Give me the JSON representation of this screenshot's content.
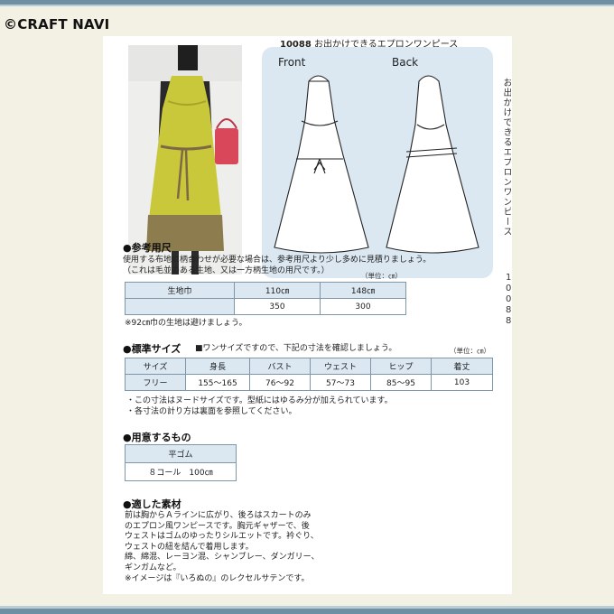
{
  "brand": "©CRAFT NAVI",
  "header": {
    "code": "10088",
    "name": "お出かけできるエプロンワンピース"
  },
  "diagram": {
    "front_label": "Front",
    "back_label": "Back"
  },
  "side": {
    "vertical_text": "お出かけできるエプロンワンピース",
    "digits": [
      "1",
      "0",
      "0",
      "8",
      "8"
    ]
  },
  "section_fabric": {
    "heading": "●参考用尺",
    "lines": [
      "使用する布地に柄合わせが必要な場合は、参考用尺より少し多めに見積りましょう。",
      "（これは毛並のある生地、又は一方柄生地の用尺です。）"
    ],
    "unit": "（単位：㎝）",
    "row_header": "生地巾",
    "widths": [
      "110㎝",
      "148㎝"
    ],
    "amounts": [
      "350",
      "300"
    ],
    "note": "※92㎝巾の生地は避けましょう。"
  },
  "section_size": {
    "heading": "●標準サイズ",
    "subheading": "■ワンサイズですので、下記の寸法を確認しましょう。",
    "unit": "（単位：㎝）",
    "columns": [
      "サイズ",
      "身長",
      "バスト",
      "ウェスト",
      "ヒップ",
      "着丈"
    ],
    "values": [
      "フリー",
      "155～165",
      "76～92",
      "57～73",
      "85～95",
      "103"
    ],
    "notes": [
      "・この寸法はヌードサイズです。型紙にはゆるみ分が加えられています。",
      "・各寸法の計り方は裏面を参照してください。"
    ]
  },
  "section_materials": {
    "heading": "●用意するもの",
    "item_header": "平ゴム",
    "item_value": "８コール　100㎝"
  },
  "section_recommended": {
    "heading": "●適した素材",
    "lines": [
      "前は胸からＡラインに広がり、後ろはスカートのみ",
      "のエプロン風ワンピースです。胸元ギャザーで、後",
      "ウェストはゴムのゆったりシルエットです。衿ぐり、",
      "ウェストの紐を結んで着用します。",
      "綿、綿混、レーヨン混、シャンブレー、ダンガリー、",
      "ギンガムなど。",
      "※イメージは『いろぬの』のレクセルサテンです。"
    ]
  },
  "colors": {
    "accent": "#6f8fa3",
    "table_header": "#dbe8f2",
    "background": "#f3f1e3",
    "dress_yellow": "#c9c73a",
    "dress_olive": "#8c7c4e",
    "bag_red": "#d9485a"
  }
}
